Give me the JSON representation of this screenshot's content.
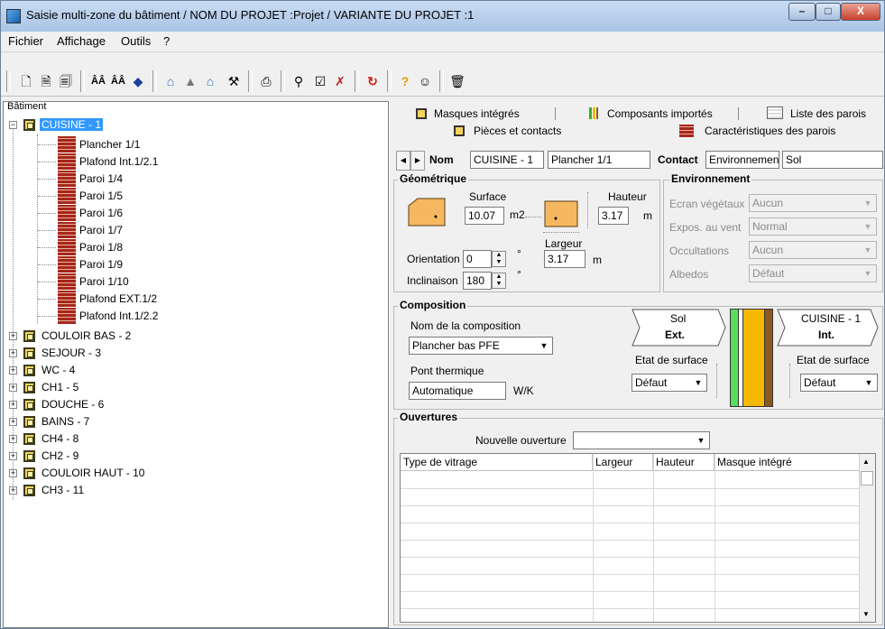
{
  "window": {
    "title": "Saisie multi-zone du bâtiment / NOM DU PROJET :Projet / VARIANTE DU PROJET :1",
    "minimize": "–",
    "maximize": "□",
    "close": "X"
  },
  "menu": [
    "Fichier",
    "Affichage",
    "Outils",
    "?"
  ],
  "tree": {
    "title": "Bâtiment",
    "root": {
      "label": "CUISINE - 1",
      "children": [
        "Plancher 1/1",
        "Plafond Int.1/2.1",
        "Paroi 1/4",
        "Paroi 1/5",
        "Paroi 1/6",
        "Paroi 1/7",
        "Paroi 1/8",
        "Paroi 1/9",
        "Paroi 1/10",
        "Plafond EXT.1/2",
        "Plafond Int.1/2.2"
      ]
    },
    "rooms": [
      "COULOIR BAS - 2",
      "SEJOUR - 3",
      "WC - 4",
      "CH1 - 5",
      "DOUCHE - 6",
      "BAINS - 7",
      "CH4 - 8",
      "CH2 - 9",
      "COULOIR HAUT - 10",
      "CH3 - 11"
    ]
  },
  "tabs": {
    "row1": [
      "Masques intégrés",
      "Composants importés",
      "Liste des parois"
    ],
    "row2": [
      "Pièces et contacts",
      "Caractéristiques des parois"
    ]
  },
  "nav": {
    "nom_label": "Nom",
    "nom_value": "CUISINE - 1",
    "paroi_value": "Plancher 1/1",
    "contact_label": "Contact",
    "contact_value": "Environnement",
    "contact_type": "Sol"
  },
  "geometrie": {
    "title": "Géométrique",
    "surface_label": "Surface",
    "surface_value": "10.07",
    "surface_unit": "m2",
    "hauteur_label": "Hauteur",
    "hauteur_value": "3.17",
    "hauteur_unit": "m",
    "largeur_label": "Largeur",
    "largeur_value": "3.17",
    "largeur_unit": "m",
    "orientation_label": "Orientation",
    "orientation_value": "0",
    "inclinaison_label": "Inclinaison",
    "inclinaison_value": "180",
    "degree": "°"
  },
  "environnement": {
    "title": "Environnement",
    "rows": [
      {
        "label": "Ecran végétaux",
        "value": "Aucun"
      },
      {
        "label": "Expos. au vent",
        "value": "Normal"
      },
      {
        "label": "Occultations",
        "value": "Aucun"
      },
      {
        "label": "Albedos",
        "value": "Défaut"
      }
    ]
  },
  "composition": {
    "title": "Composition",
    "nom_label": "Nom de la composition",
    "nom_value": "Plancher bas PFE",
    "pont_label": "Pont thermique",
    "pont_value": "Automatique",
    "pont_unit": "W/K",
    "left_name": "Sol",
    "left_side": "Ext.",
    "right_name": "CUISINE - 1",
    "right_side": "Int.",
    "etat_label": "Etat de surface",
    "etat_left": "Défaut",
    "etat_right": "Défaut"
  },
  "ouvertures": {
    "title": "Ouvertures",
    "nouvelle_label": "Nouvelle ouverture",
    "nouvelle_value": "",
    "columns": [
      "Type de vitrage",
      "Largeur",
      "Hauteur",
      "Masque intégré"
    ]
  },
  "colors": {
    "selection": "#3399ff",
    "layer_green": "#5cdc5c",
    "layer_orange": "#f5b800",
    "layer_brown": "#8c5a1c"
  }
}
